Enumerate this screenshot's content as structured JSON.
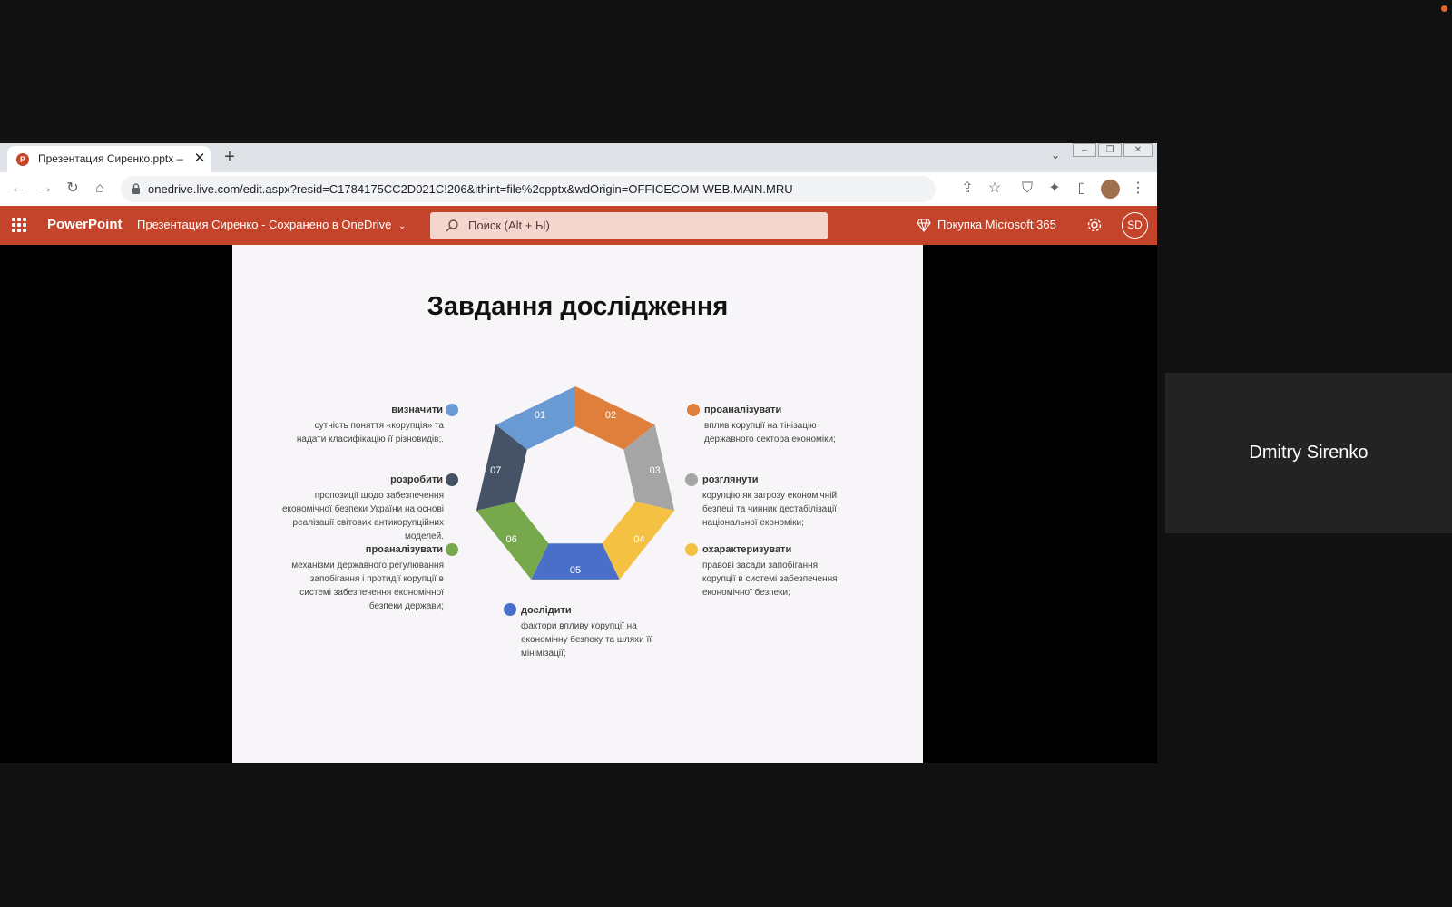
{
  "browser": {
    "tab_title": "Презентация Сиренко.pptx — M",
    "url": "onedrive.live.com/edit.aspx?resid=C1784175CC2D021C!206&ithint=file%2cpptx&wdOrigin=OFFICECOM-WEB.MAIN.MRU"
  },
  "office": {
    "app_name": "PowerPoint",
    "doc_title": "Презентация Сиренко  -  Сохранено в OneDrive",
    "search_placeholder": "Поиск (Alt + Ы)",
    "buy_label": "Покупка Microsoft 365",
    "user_initials": "SD"
  },
  "slide": {
    "title": "Завдання дослідження",
    "segments": [
      {
        "num": "01",
        "color": "#6a9ad4",
        "heading": "визначити",
        "desc": [
          "сутність поняття «корупція» та",
          "надати класифікацію її різновидів;."
        ]
      },
      {
        "num": "02",
        "color": "#e07f3c",
        "heading": "проаналізувати",
        "desc": [
          "вплив корупції на тінізацію",
          "державного сектора економіки;"
        ]
      },
      {
        "num": "03",
        "color": "#a5a5a5",
        "heading": "розглянути",
        "desc": [
          "корупцію як загрозу економічній",
          "безпеці та чинник дестабілізації",
          "національної економіки;"
        ]
      },
      {
        "num": "04",
        "color": "#f4c142",
        "heading": "охарактеризувати",
        "desc": [
          "правові засади запобігання",
          "корупції в системі забезпечення",
          "економічної безпеки;"
        ]
      },
      {
        "num": "05",
        "color": "#4a6fc8",
        "heading": "дослідити",
        "desc": [
          "фактори впливу корупції на",
          "економічну безпеку та шляхи її",
          "мінімізації;"
        ]
      },
      {
        "num": "06",
        "color": "#78a84c",
        "heading": "проаналізувати",
        "desc": [
          "механізми державного регулювання",
          "запобігання і протидії корупції в",
          "системі забезпечення економічної",
          "безпеки держави;"
        ]
      },
      {
        "num": "07",
        "color": "#465366",
        "heading": "розробити",
        "desc": [
          "пропозиції щодо забезпечення",
          "економічної безпеки України на основі",
          "реалізації світових антикорупційних",
          "моделей."
        ]
      }
    ]
  },
  "participant": {
    "name": "Dmitry Sirenko"
  }
}
